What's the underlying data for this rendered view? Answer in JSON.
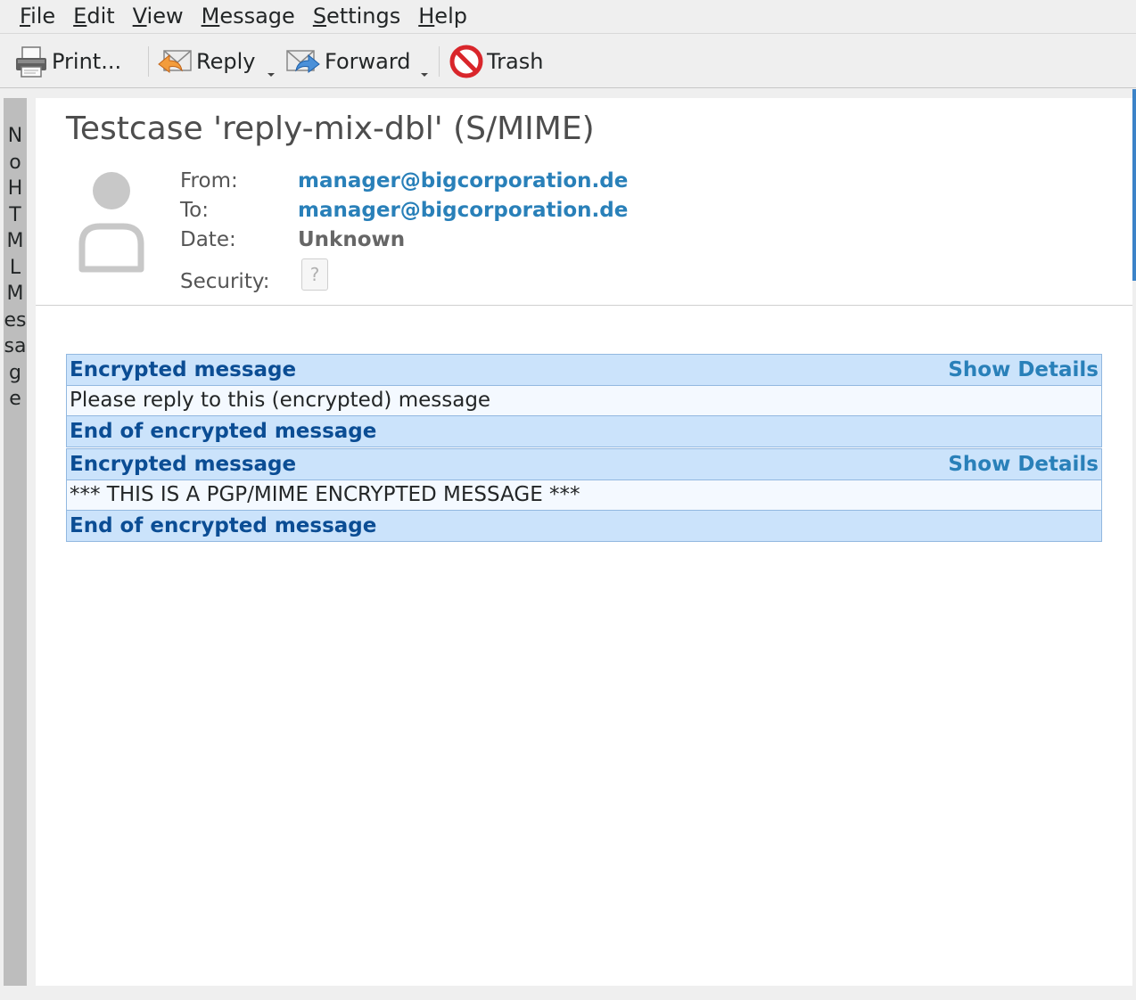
{
  "menubar": {
    "items": [
      {
        "mnemonic": "F",
        "rest": "ile"
      },
      {
        "mnemonic": "E",
        "rest": "dit"
      },
      {
        "mnemonic": "V",
        "rest": "iew"
      },
      {
        "mnemonic": "M",
        "rest": "essage"
      },
      {
        "mnemonic": "S",
        "rest": "ettings"
      },
      {
        "mnemonic": "H",
        "rest": "elp"
      }
    ]
  },
  "toolbar": {
    "print_label": "Print...",
    "reply_label": "Reply",
    "forward_label": "Forward",
    "trash_label": "Trash",
    "icons": {
      "print": "printer-icon",
      "reply": "reply-envelope-icon",
      "forward": "forward-envelope-icon",
      "trash": "trash-prohibited-icon"
    }
  },
  "side_panel": {
    "text": "No HTML Message"
  },
  "message": {
    "subject": "Testcase 'reply-mix-dbl' (S/MIME)",
    "from_label": "From:",
    "from_value": "manager@bigcorporation.de",
    "to_label": "To:",
    "to_value": "manager@bigcorporation.de",
    "date_label": "Date:",
    "date_value": "Unknown",
    "security_label": "Security:",
    "security_icon_glyph": "?"
  },
  "blocks": [
    {
      "header": "Encrypted message",
      "details_label": "Show Details",
      "body": "Please reply to this (encrypted) message",
      "footer": "End of encrypted message"
    },
    {
      "header": "Encrypted message",
      "details_label": "Show Details",
      "body": "*** THIS IS A PGP/MIME ENCRYPTED MESSAGE ***",
      "footer": "End of encrypted message"
    }
  ],
  "colors": {
    "link": "#2980b9",
    "block_header_bg": "#cbe3fb",
    "block_header_text": "#0b4d94",
    "block_border": "#92b8e0",
    "side_strip": "#bdbdbd"
  }
}
